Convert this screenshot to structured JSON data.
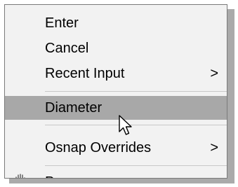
{
  "context_menu": {
    "items": [
      {
        "label": "Enter",
        "has_submenu": false,
        "highlighted": false
      },
      {
        "label": "Cancel",
        "has_submenu": false,
        "highlighted": false
      },
      {
        "label": "Recent Input",
        "has_submenu": true,
        "highlighted": false
      },
      {
        "label": "Diameter",
        "has_submenu": false,
        "highlighted": true
      },
      {
        "label": "Osnap Overrides",
        "has_submenu": true,
        "highlighted": false
      },
      {
        "label": "P",
        "has_submenu": false,
        "highlighted": false
      }
    ],
    "submenu_glyph": ">",
    "icons": {
      "pan_item_icon": "hand-pan-icon",
      "cursor": "arrow-cursor-icon"
    },
    "colors": {
      "menu_background": "#f2f2f2",
      "highlight": "#a8a8a8",
      "border": "#7a7a7a",
      "separator": "#c8c8c8",
      "shadow": "#aaaaaa"
    }
  }
}
